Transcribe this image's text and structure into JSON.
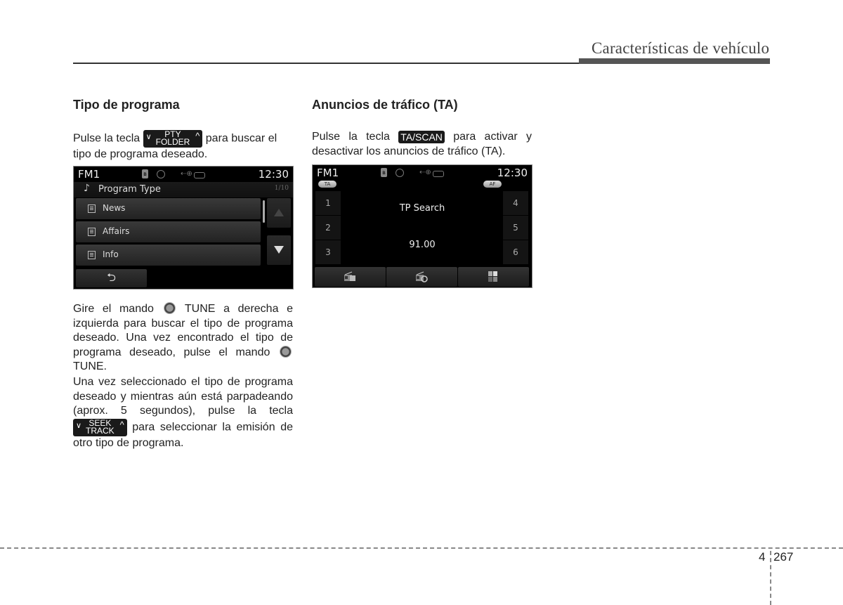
{
  "header": {
    "section_title": "Características de vehículo"
  },
  "left": {
    "heading": "Tipo de programa",
    "intro_before": "Pulse la tecla",
    "intro_key": {
      "top": "PTY",
      "bottom": "FOLDER"
    },
    "intro_after1": "para buscar el",
    "intro_after2": "tipo de programa deseado.",
    "screen": {
      "band": "FM1",
      "clock": "12:30",
      "title": "Program Type",
      "page_indicator": "1/10",
      "items": [
        "News",
        "Affairs",
        "Info"
      ],
      "back_label": "⮌"
    },
    "p2_a": "Gire el mando",
    "p2_b": "TUNE a derecha e izquierda para buscar el tipo de programa deseado. Una vez encontrado el tipo de programa deseado, pulse el mando",
    "p2_c": "TUNE.",
    "p3_a": "Una vez seleccionado el tipo de programa deseado y mientras aún está parpadeando (aprox. 5 segundos), pulse la tecla",
    "p3_key": {
      "top": "SEEK",
      "bottom": "TRACK"
    },
    "p3_b": "para seleccionar la emisión de otro tipo de programa."
  },
  "right": {
    "heading": "Anuncios de tráfico (TA)",
    "intro_before": "Pulse la tecla",
    "intro_key": "TA/SCAN",
    "intro_after": "para activar y desactivar los anuncios de tráfico (TA).",
    "screen": {
      "band": "FM1",
      "clock": "12:30",
      "ta_label": "TA",
      "af_label": "AF",
      "presets_left": [
        "1",
        "2",
        "3"
      ],
      "presets_right": [
        "4",
        "5",
        "6"
      ],
      "status_text": "TP Search",
      "frequency": "91.00"
    }
  },
  "footer": {
    "chapter": "4",
    "page": "267"
  }
}
